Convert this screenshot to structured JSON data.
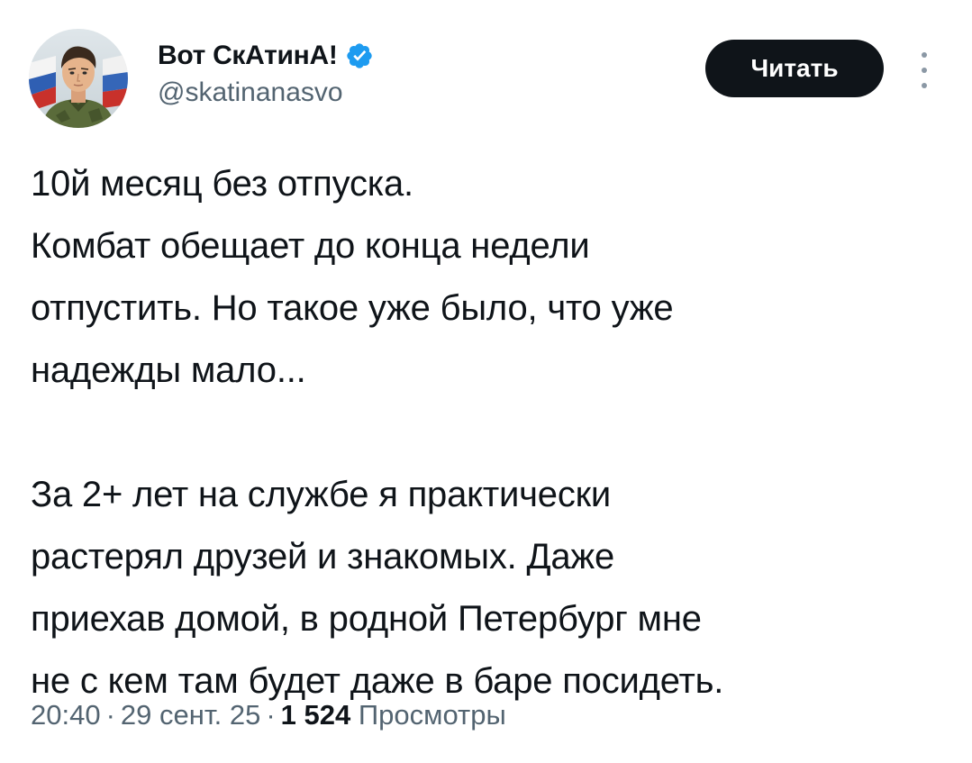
{
  "author": {
    "display_name": "Вот СкАтинА!",
    "handle": "@skatinanasvo",
    "verified": true,
    "verified_color": "#1d9bf0",
    "avatar_icon": "soldier-portrait-avatar"
  },
  "actions": {
    "follow_label": "Читать",
    "more_icon": "vertical-dots-icon"
  },
  "tweet": {
    "paragraphs": [
      "10й месяц без отпуска.\nКомбат обещает до конца недели\nотпустить. Но такое уже было, что уже\nнадежды мало...",
      "За 2+ лет на службе я практически\nрастерял друзей и знакомых. Даже\nприехав домой, в родной Петербург мне\nне с кем там будет даже в баре посидеть."
    ]
  },
  "meta": {
    "time": "20:40",
    "separator": "·",
    "date": "29 сент. 25",
    "views_count": "1 524",
    "views_label": "Просмотры"
  },
  "colors": {
    "text_primary": "#0f1419",
    "text_secondary": "#536471",
    "button_bg": "#0f1419",
    "button_text": "#ffffff"
  }
}
